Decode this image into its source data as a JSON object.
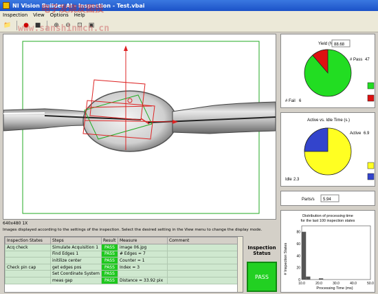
{
  "window": {
    "title": "NI Vision Builder AI - Inspection - Test.vbai"
  },
  "watermark": {
    "line1": "电子发烧友图技",
    "line2": "www.sanshinmcn.cn"
  },
  "menu": [
    "Inspection",
    "View",
    "Options",
    "Help"
  ],
  "image": {
    "size_label": "640x480 1X"
  },
  "hint_text": "Images displayed according to the settings of the inspection. Select the desired setting in the View menu to change the display mode.",
  "yield": {
    "label": "Yield (%)",
    "value": "88.68",
    "pass_label": "# Pass",
    "pass_value": "47",
    "fail_label": "# Fail",
    "fail_value": "6",
    "colors": {
      "pass": "#22dd22",
      "fail": "#dd1111"
    }
  },
  "active_idle": {
    "title": "Active vs. Idle Time (s.)",
    "active_label": "Active",
    "active_value": "6.9",
    "idle_label": "Idle",
    "idle_value": "2.3",
    "colors": {
      "active": "#ffff22",
      "idle": "#3344cc"
    }
  },
  "parts": {
    "label": "Parts/s",
    "value": "5.94"
  },
  "chart_data": {
    "type": "bar",
    "title": "Distribution of processing time\nfor the last 100 inspection states",
    "title_line1": "Distribution of processing time",
    "title_line2": "for the last 100 inspection states",
    "xlabel": "Processing Time (ms)",
    "ylabel": "# Inspection States",
    "xlim": [
      10,
      50
    ],
    "ylim": [
      0,
      90
    ],
    "x_ticks": [
      "10.0",
      "20.0",
      "30.0",
      "40.0",
      "50.0"
    ],
    "y_ticks": [
      "0",
      "20",
      "40",
      "60",
      "80"
    ],
    "bins": [
      {
        "start": 10,
        "end": 12.5,
        "value": 80
      },
      {
        "start": 12.5,
        "end": 15,
        "value": 5
      },
      {
        "start": 20,
        "end": 22.5,
        "value": 2
      }
    ]
  },
  "table": {
    "headers": [
      "Inspection States",
      "Steps",
      "Result",
      "Measure",
      "Comment"
    ],
    "rows": [
      [
        "Acq check",
        "Simulate Acquisition 1",
        "PASS",
        "image 06.jpg",
        ""
      ],
      [
        "",
        "Find Edges 1",
        "PASS",
        "# Edges = 7",
        ""
      ],
      [
        "",
        "initilize center",
        "PASS",
        "Counter = 1",
        ""
      ],
      [
        "Check pin cap",
        "get edges pos",
        "PASS",
        "Index = 3",
        ""
      ],
      [
        "",
        "Set Coordinate System",
        "PASS",
        "",
        ""
      ],
      [
        "",
        "meas gap",
        "PASS",
        "Distance = 33.92 pix",
        ""
      ]
    ]
  },
  "inspection_status": {
    "title": "Inspection Status",
    "value": "PASS"
  }
}
